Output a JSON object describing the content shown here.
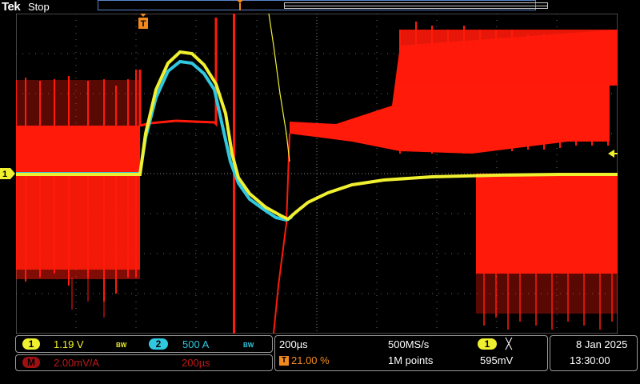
{
  "header": {
    "brand": "Tek",
    "run_status": "Stop"
  },
  "channel_marker": "1",
  "trigger_marker": "T",
  "channel1": {
    "label": "1",
    "scale": "1.19 V",
    "bw": "BW",
    "color": "#f0f030"
  },
  "channel2": {
    "label": "2",
    "scale": "500 A",
    "bw": "BW",
    "color": "#30c8e0"
  },
  "math": {
    "label": "M",
    "scale": "2.00mV/A",
    "timebase": "200µs",
    "color": "#e02020"
  },
  "timebase": {
    "horizontal_scale": "200µs",
    "sample_rate": "500MS/s",
    "trigger_position": "21.00 %",
    "record_length": "1M points",
    "trigger_source": "1",
    "trigger_slope": "╳",
    "trigger_level": "595mV"
  },
  "datetime": {
    "date": "8 Jan  2025",
    "time": "13:30:00"
  },
  "colors": {
    "grid": "#7a7a7a",
    "trigger": "#f28a1e",
    "accent": "#5a86c8"
  }
}
